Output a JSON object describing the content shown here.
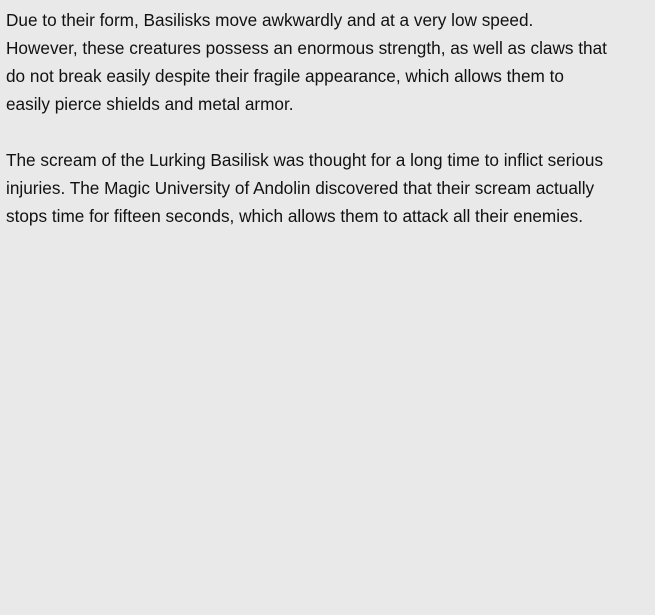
{
  "document": {
    "paragraphs": [
      "Due to their form, Basilisks move awkwardly and at a very low speed.\nHowever, these creatures possess an enormous strength, as well as claws that\ndo not break easily despite their fragile appearance, which allows them to\neasily pierce shields and metal armor.",
      "The scream of the Lurking Basilisk was thought for a long time to inflict serious\ninjuries. The Magic University of Andolin discovered that their scream actually\nstops time for fifteen seconds, which allows them to attack all their enemies."
    ]
  }
}
